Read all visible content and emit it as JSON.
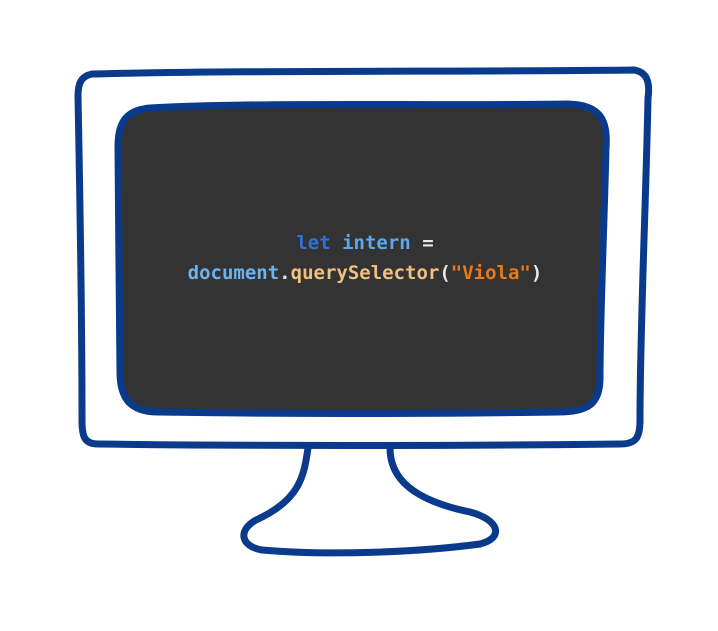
{
  "code": {
    "line1": {
      "keyword": "let",
      "variable": "intern",
      "operator": "="
    },
    "line2": {
      "object": "document",
      "dot": ".",
      "method": "querySelector",
      "open_paren": "(",
      "string": "\"Viola\"",
      "close_paren": ")"
    }
  },
  "colors": {
    "frame": "#0a3a8c",
    "screen": "#333333",
    "keyword": "#2f6fe0",
    "variable": "#5aa8f0",
    "method": "#f0c080",
    "string": "#e87a1c"
  },
  "icons": {
    "illustration": "computer-monitor-icon"
  }
}
